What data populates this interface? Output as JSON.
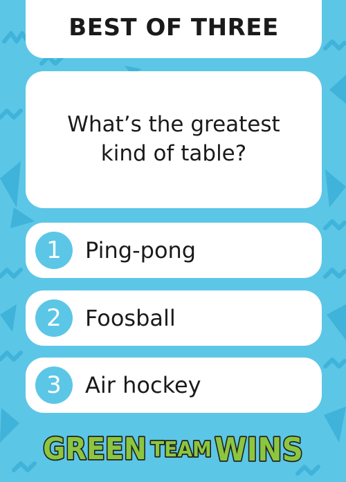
{
  "title": "BEST OF THREE",
  "question": "What’s the greatest kind of table?",
  "options": [
    {
      "number": "1",
      "label": "Ping-pong"
    },
    {
      "number": "2",
      "label": "Foosball"
    },
    {
      "number": "3",
      "label": "Air hockey"
    }
  ],
  "logo": {
    "word1": "GREEN",
    "word2": "TEAM",
    "word3": "WINS"
  },
  "colors": {
    "background": "#5cc6e6",
    "pattern": "#3fb3da",
    "card": "#ffffff",
    "badge": "#5cc6e6",
    "logo_green": "#8cc63f",
    "logo_outline": "#1f1f1f"
  }
}
